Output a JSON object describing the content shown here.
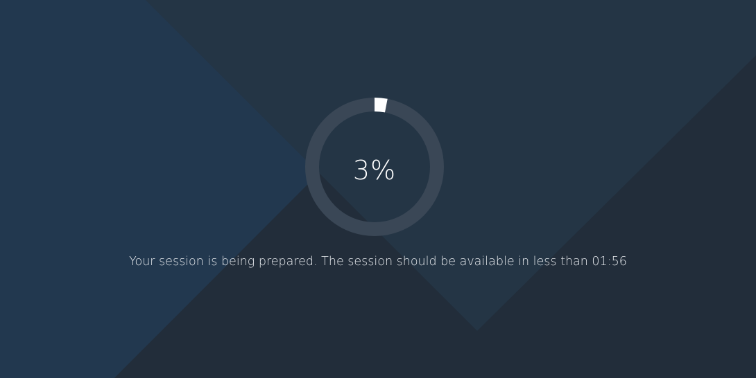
{
  "loader": {
    "progress_percent": 3,
    "progress_label": "3%",
    "message": "Your session is being prepared. The session should be available in less than 01:56"
  },
  "colors": {
    "background": "#232f3e",
    "shape_light": "#22384f",
    "shape_mid": "#243545",
    "shape_dark": "#222d3a",
    "ring_track": "#3a4756",
    "ring_progress": "#ffffff",
    "text": "#ffffff"
  }
}
